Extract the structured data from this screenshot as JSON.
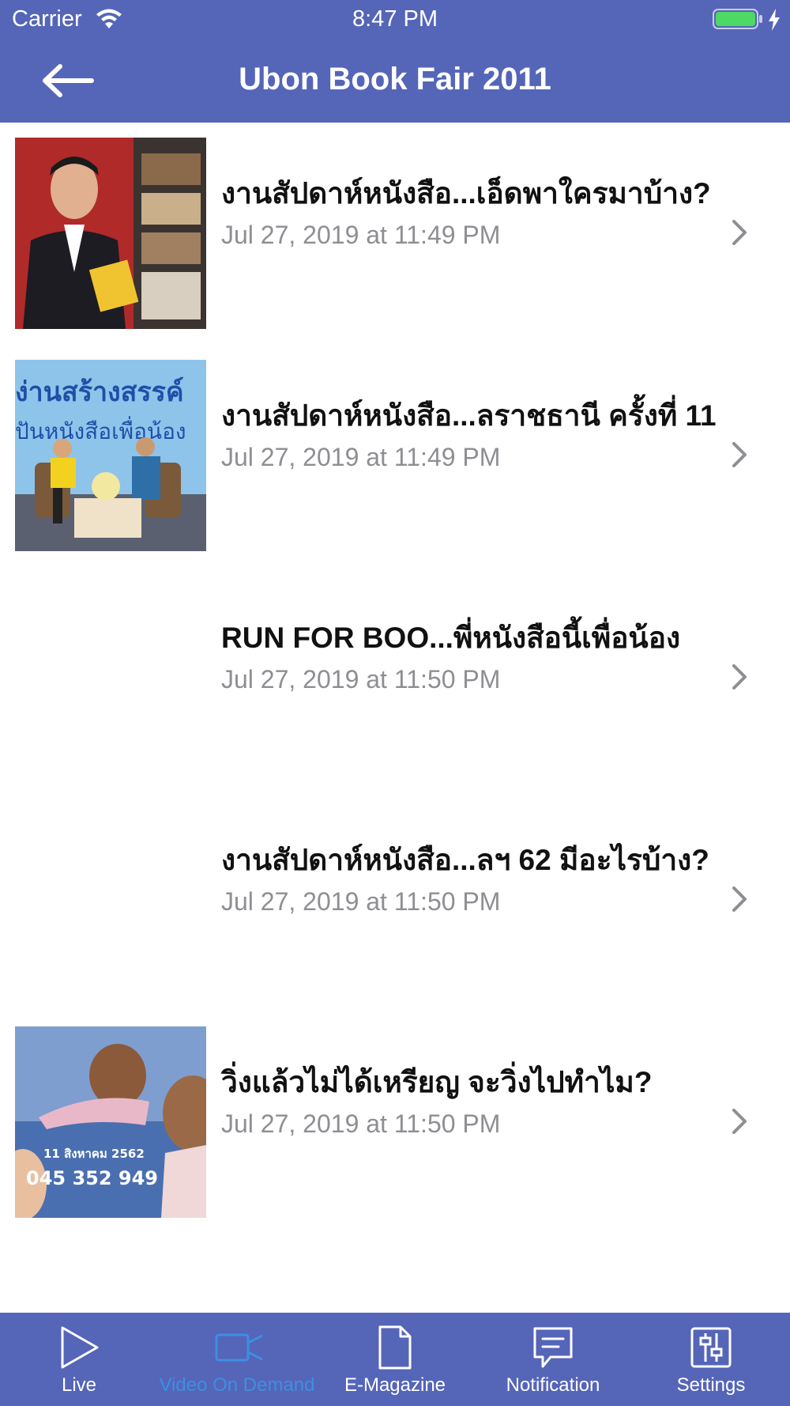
{
  "status_bar": {
    "carrier": "Carrier",
    "time": "8:47 PM",
    "battery_icon": "battery-full-charging-icon"
  },
  "header": {
    "back_icon": "arrow-left-icon",
    "title": "Ubon Book Fair 2011",
    "background_color": "#5565b8"
  },
  "videos": [
    {
      "title": "งานสัปดาห์หนังสือ...เอ็ดพาใครมาบ้าง?",
      "date": "Jul 27, 2019 at 11:49 PM",
      "thumbnail": "photo"
    },
    {
      "title": "งานสัปดาห์หนังสือ...ลราชธานี ครั้งที่ 11",
      "date": "Jul 27, 2019 at 11:49 PM",
      "thumbnail": "photo",
      "thumbnail_banner_text": "ง่านสร้างสรรค์",
      "thumbnail_banner_text_2": "ปันหนังสือเพื่อน้อง"
    },
    {
      "title": "RUN FOR BOO...พี่หนังสือนี้เพื่อน้อง",
      "date": "Jul 27, 2019 at 11:50 PM",
      "thumbnail": "none"
    },
    {
      "title": "งานสัปดาห์หนังสือ...ลฯ 62 มีอะไรบ้าง?",
      "date": "Jul 27, 2019 at 11:50 PM",
      "thumbnail": "none"
    },
    {
      "title": "วิ่งแล้วไม่ได้เหรียญ จะวิ่งไปทำไม?",
      "date": "Jul 27, 2019 at 11:50 PM",
      "thumbnail": "photo",
      "thumbnail_date_text": "11 สิงหาคม 2562",
      "thumbnail_phone_text": "045 352  949"
    }
  ],
  "tab_bar": {
    "active_color": "#3d8fe0",
    "tabs": [
      {
        "label": "Live",
        "icon": "play-icon",
        "active": false
      },
      {
        "label": "Video On Demand",
        "icon": "video-camera-icon",
        "active": true
      },
      {
        "label": "E-Magazine",
        "icon": "document-icon",
        "active": false
      },
      {
        "label": "Notification",
        "icon": "chat-bubble-icon",
        "active": false
      },
      {
        "label": "Settings",
        "icon": "sliders-icon",
        "active": false
      }
    ]
  }
}
